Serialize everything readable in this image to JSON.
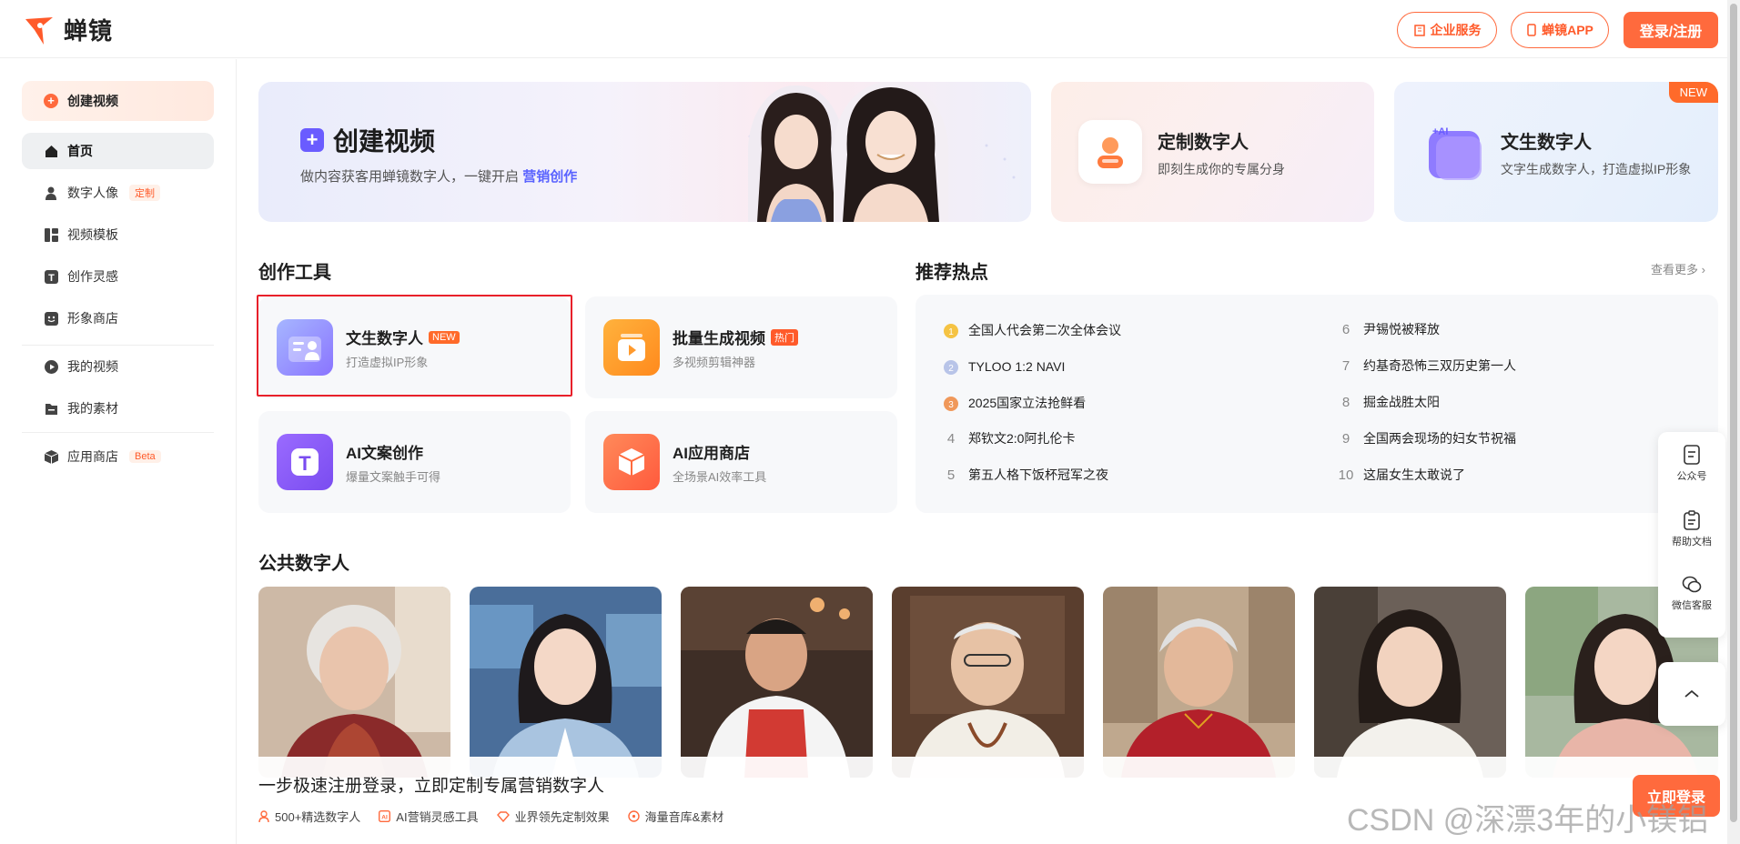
{
  "header": {
    "app_name": "蝉镜",
    "enterprise_label": "企业服务",
    "app_label": "蝉镜APP",
    "login_label": "登录/注册"
  },
  "sidebar": {
    "create_label": "创建视频",
    "items": [
      {
        "label": "首页",
        "icon": "home-icon"
      },
      {
        "label": "数字人像",
        "tag": "定制",
        "icon": "person-icon"
      },
      {
        "label": "视频模板",
        "icon": "template-icon"
      },
      {
        "label": "创作灵感",
        "icon": "text-icon"
      },
      {
        "label": "形象商店",
        "icon": "store-icon"
      },
      {
        "label": "我的视频",
        "icon": "play-icon"
      },
      {
        "label": "我的素材",
        "icon": "folder-icon"
      },
      {
        "label": "应用商店",
        "tag": "Beta",
        "icon": "cube-icon"
      }
    ]
  },
  "banner": {
    "title": "创建视频",
    "subtitle": "做内容获客用蝉镜数字人，一键开启",
    "subtitle_link": "营销创作"
  },
  "top_cards": [
    {
      "title": "定制数字人",
      "subtitle": "即刻生成你的专属分身"
    },
    {
      "title": "文生数字人",
      "subtitle": "文字生成数字人，打造虚拟IP形象",
      "corner": "NEW"
    }
  ],
  "tools": {
    "section_title": "创作工具",
    "items": [
      {
        "title": "文生数字人",
        "tag": "NEW",
        "subtitle": "打造虚拟IP形象"
      },
      {
        "title": "批量生成视频",
        "tag": "热门",
        "subtitle": "多视频剪辑神器"
      },
      {
        "title": "AI文案创作",
        "subtitle": "爆量文案触手可得"
      },
      {
        "title": "AI应用商店",
        "subtitle": "全场景AI效率工具"
      }
    ]
  },
  "hot": {
    "section_title": "推荐热点",
    "more_label": "查看更多 ›",
    "items": [
      {
        "rank": "1",
        "text": "全国人代会第二次全体会议"
      },
      {
        "rank": "2",
        "text": "TYLOO 1:2 NAVI"
      },
      {
        "rank": "3",
        "text": "2025国家立法抢鲜看"
      },
      {
        "rank": "4",
        "text": "郑钦文2:0阿扎伦卡"
      },
      {
        "rank": "5",
        "text": "第五人格下饭杯冠军之夜"
      },
      {
        "rank": "6",
        "text": "尹锡悦被释放"
      },
      {
        "rank": "7",
        "text": "约基奇恐怖三双历史第一人"
      },
      {
        "rank": "8",
        "text": "掘金战胜太阳"
      },
      {
        "rank": "9",
        "text": "全国两会现场的妇女节祝福"
      },
      {
        "rank": "10",
        "text": "这届女生太敢说了"
      }
    ]
  },
  "public_avatars": {
    "section_title": "公共数字人"
  },
  "register_bar": {
    "title": "一步极速注册登录，立即定制专属营销数字人",
    "features": [
      "500+精选数字人",
      "AI营销灵感工具",
      "业界领先定制效果",
      "海量音库&素材"
    ],
    "button": "立即登录"
  },
  "float_panel": {
    "items": [
      "公众号",
      "帮助文档",
      "微信客服"
    ]
  },
  "watermark": "CSDN @深漂3年的小镁铝",
  "colors": {
    "accent": "#ff6a3d",
    "highlight": "#e8202a",
    "link": "#5a63ff"
  }
}
